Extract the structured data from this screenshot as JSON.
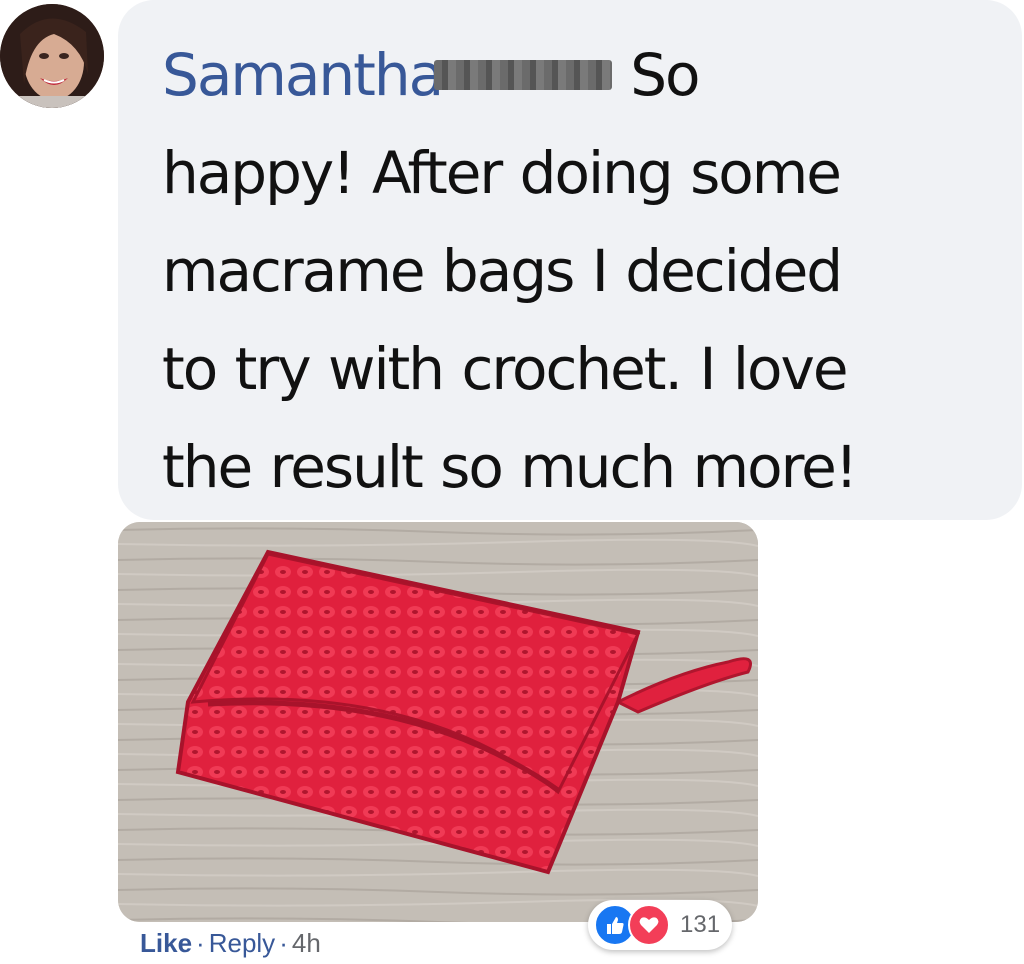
{
  "comment": {
    "author": "Samantha",
    "text_first": "So",
    "text_lines": [
      "happy! After doing some",
      "macrame bags I decided",
      "to try with crochet. I love",
      "the result so much more!"
    ]
  },
  "reactions": {
    "icons": [
      "like-icon",
      "love-icon"
    ],
    "count": "131",
    "like_color": "#1877f2",
    "love_color": "#f33e58"
  },
  "actions": {
    "like": "Like",
    "separator": "·",
    "reply": "Reply",
    "time": "4h"
  },
  "colors": {
    "author": "#385898",
    "bubble": "#f0f2f5",
    "text": "#111111"
  }
}
